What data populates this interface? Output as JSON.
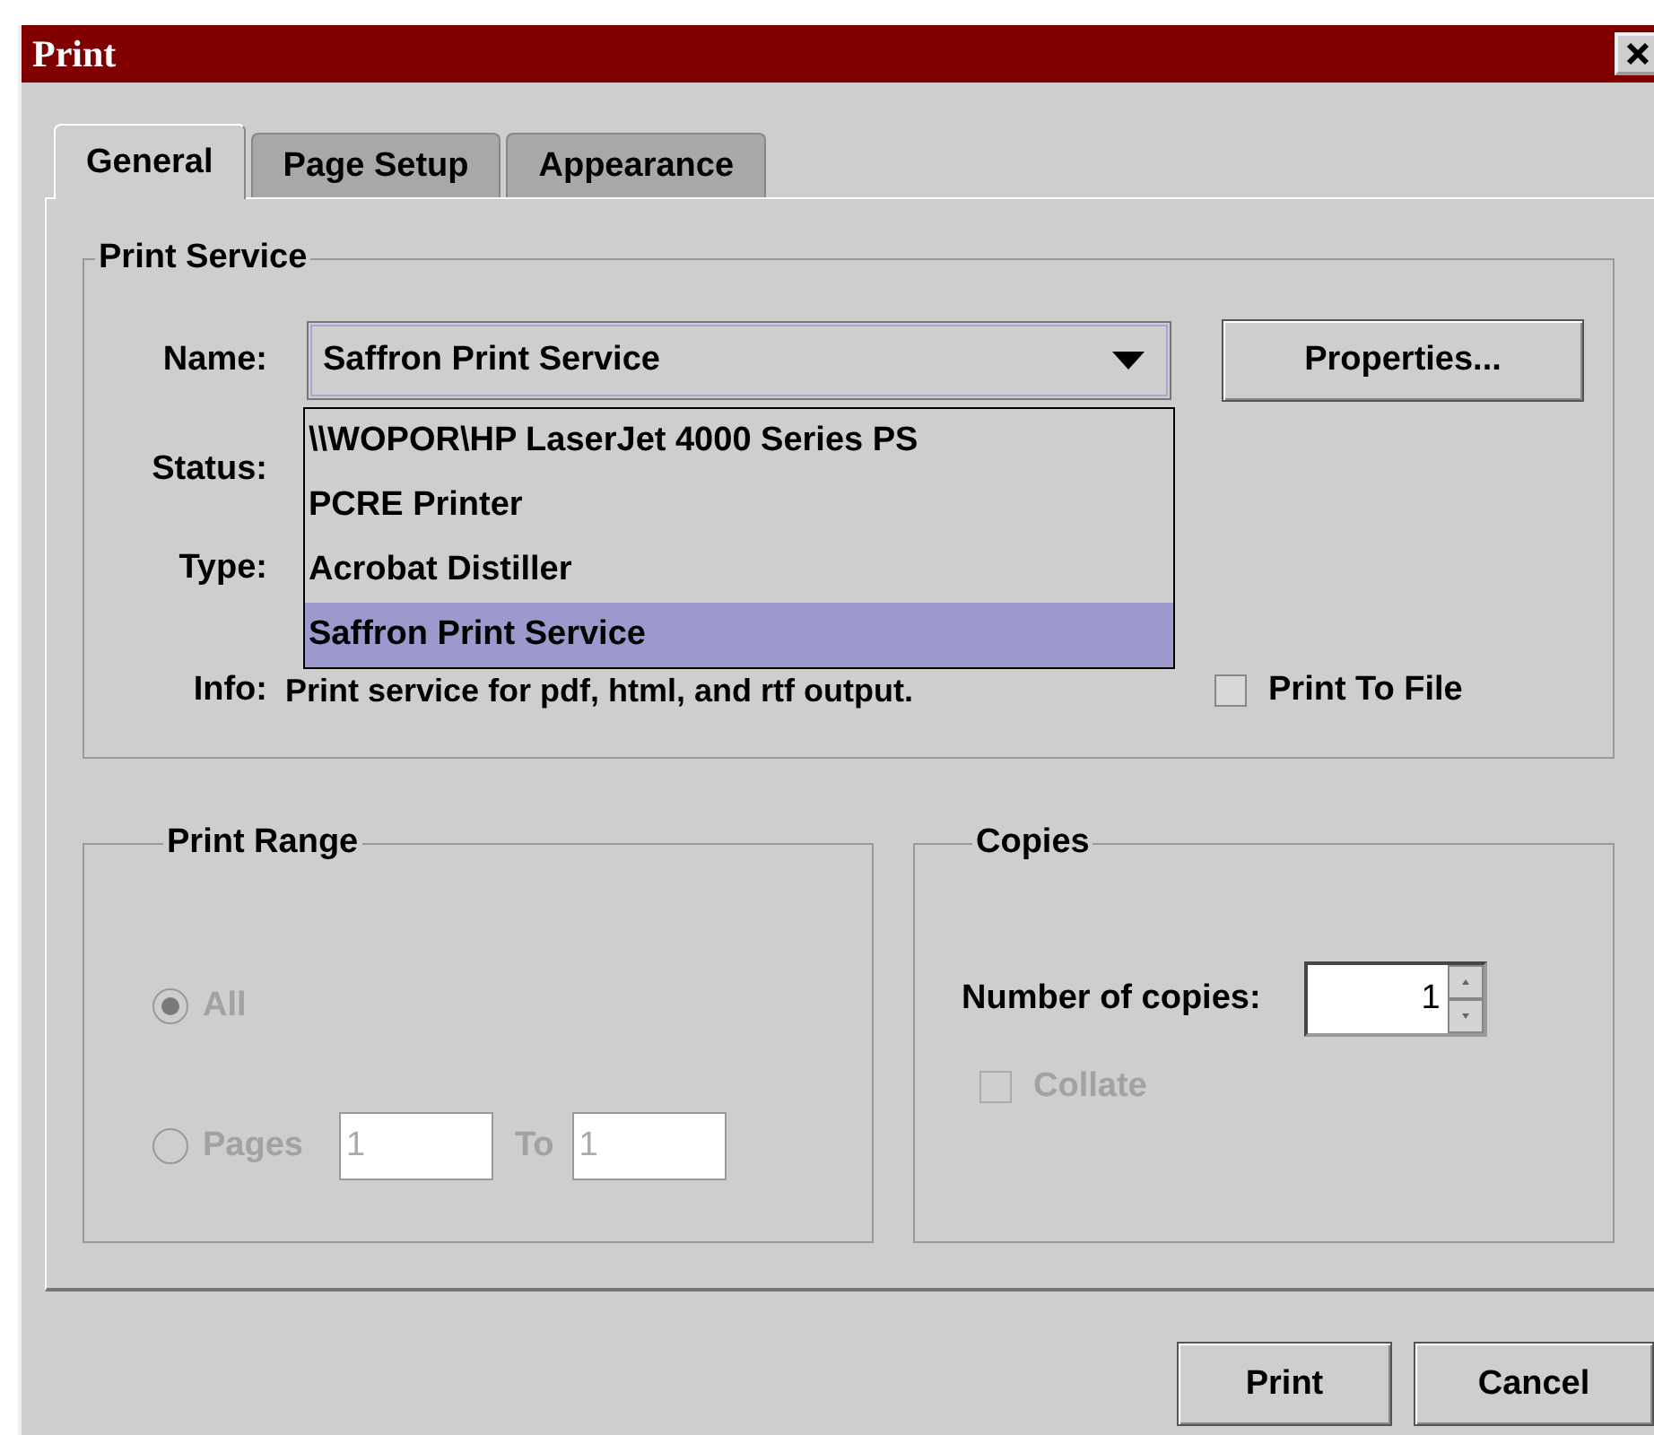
{
  "window": {
    "title": "Print"
  },
  "tabs": [
    {
      "label": "General",
      "selected": true
    },
    {
      "label": "Page Setup",
      "selected": false
    },
    {
      "label": "Appearance",
      "selected": false
    }
  ],
  "print_service": {
    "title": "Print Service",
    "name_label": "Name:",
    "name_value": "Saffron Print Service",
    "properties_button": "Properties...",
    "status_label": "Status:",
    "type_label": "Type:",
    "info_label": "Info:",
    "info_text": "Print service for pdf, html, and rtf output.",
    "print_to_file": {
      "label": "Print To File",
      "checked": false
    },
    "dropdown": {
      "expanded": true,
      "items": [
        {
          "label": "\\\\WOPOR\\HP LaserJet 4000 Series PS",
          "selected": false
        },
        {
          "label": "PCRE Printer",
          "selected": false
        },
        {
          "label": "Acrobat Distiller",
          "selected": false
        },
        {
          "label": "Saffron Print Service",
          "selected": true
        }
      ]
    }
  },
  "print_range": {
    "title": "Print Range",
    "options": [
      {
        "label": "All",
        "selected": true,
        "disabled": true
      },
      {
        "label": "Pages",
        "selected": false,
        "disabled": true
      }
    ],
    "pages_from": "1",
    "to_label": "To",
    "pages_to": "1"
  },
  "copies": {
    "title": "Copies",
    "label": "Number of copies:",
    "value": "1",
    "collate": {
      "label": "Collate",
      "checked": false,
      "disabled": true
    }
  },
  "buttons": [
    "Print",
    "Cancel"
  ]
}
